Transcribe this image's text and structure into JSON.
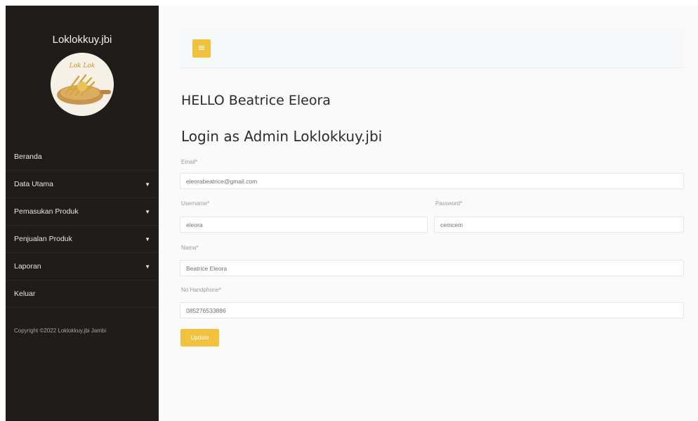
{
  "sidebar": {
    "brand": "Loklokkuy.jbi",
    "logo_text": "Lok Lok",
    "items": [
      {
        "label": "Beranda",
        "has_caret": false
      },
      {
        "label": "Data Utama",
        "has_caret": true
      },
      {
        "label": "Pemasukan Produk",
        "has_caret": true
      },
      {
        "label": "Penjualan Produk",
        "has_caret": true
      },
      {
        "label": "Laporan",
        "has_caret": true
      },
      {
        "label": "Keluar",
        "has_caret": false
      }
    ],
    "caret": "▼",
    "copyright": "Copyright ©2022 Loklokkuy.jbi Jambi"
  },
  "topbar": {
    "menu_icon": "≡"
  },
  "main": {
    "greeting": "HELLO Beatrice Eleora",
    "title": "Login as Admin Loklokkuy.jbi"
  },
  "form": {
    "email": {
      "label": "Email*",
      "value": "eleorabeatrice@gmail.com"
    },
    "username": {
      "label": "Username*",
      "value": "eleora"
    },
    "password": {
      "label": "Password*",
      "value": "cemcem"
    },
    "nama": {
      "label": "Nama*",
      "value": "Beatrice Eleora"
    },
    "no_handphone": {
      "label": "No Handphone*",
      "value": "085276533886"
    },
    "submit_label": "Update"
  },
  "colors": {
    "sidebar_bg": "#1f1c1a",
    "accent": "#f0c13a"
  }
}
